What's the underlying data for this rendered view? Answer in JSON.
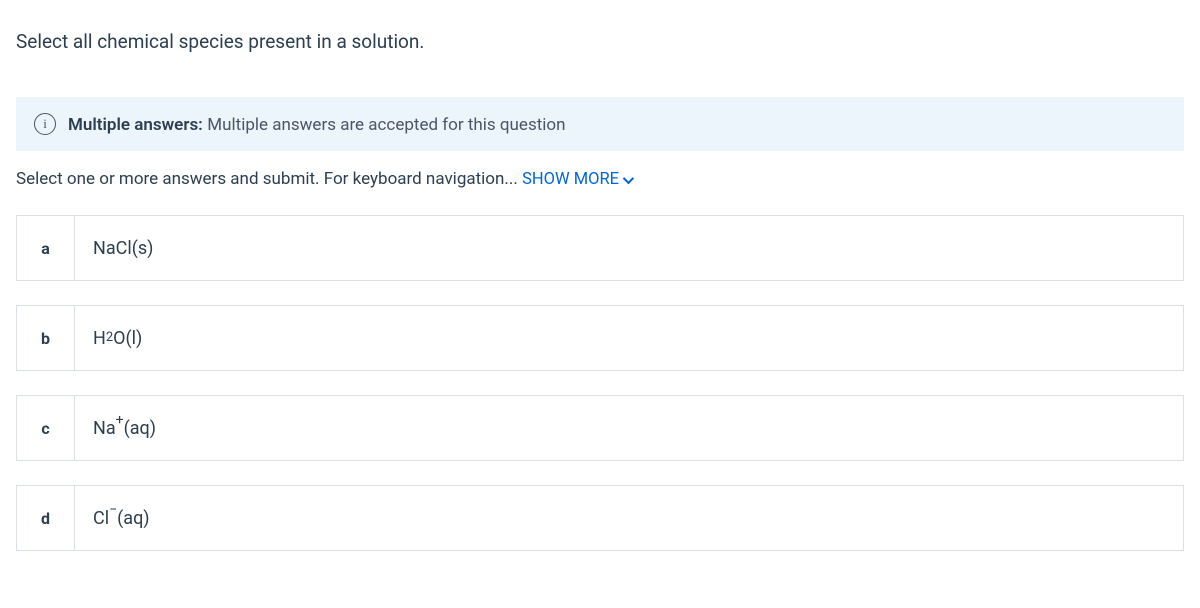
{
  "question": "Select all chemical species present in a solution.",
  "info": {
    "icon": "i",
    "label": "Multiple answers:",
    "text": "Multiple answers are accepted for this question"
  },
  "instruction": "Select one or more answers and submit. For keyboard navigation...",
  "show_more": "SHOW MORE",
  "options": [
    {
      "letter": "a",
      "html": "NaCl(s)"
    },
    {
      "letter": "b",
      "html": "H<sub>2</sub>O(l)"
    },
    {
      "letter": "c",
      "html": "Na<span class=\"sup-plus\">+</span>(aq)"
    },
    {
      "letter": "d",
      "html": "Cl<span class=\"sup-minus\">−</span>(aq)"
    }
  ]
}
